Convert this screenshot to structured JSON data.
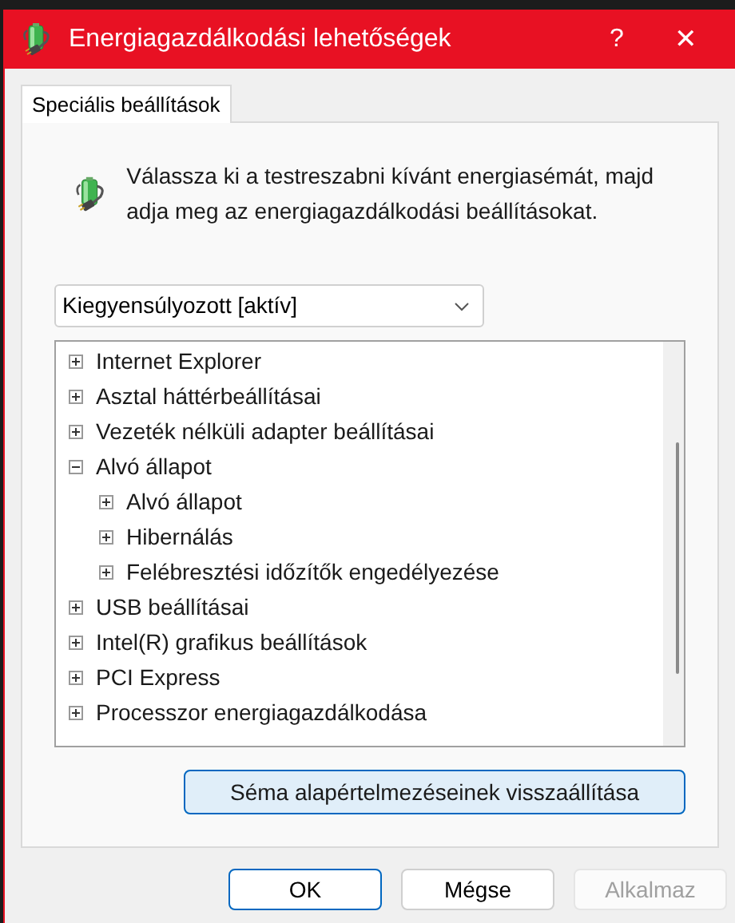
{
  "window": {
    "title": "Energiagazdálkodási lehetőségek",
    "help": "?",
    "close": "✕"
  },
  "tabs": [
    {
      "label": "Speciális beállítások",
      "selected": true
    }
  ],
  "instruction": "Válassza ki a testreszabni kívánt energiasémát, majd adja meg az energiagazdálkodási beállításokat.",
  "plan_select": {
    "value": "Kiegyensúlyozott [aktív]"
  },
  "tree": [
    {
      "label": "Internet Explorer",
      "expanded": false
    },
    {
      "label": "Asztal háttérbeállításai",
      "expanded": false
    },
    {
      "label": "Vezeték nélküli adapter beállításai",
      "expanded": false
    },
    {
      "label": "Alvó állapot",
      "expanded": true,
      "children": [
        {
          "label": "Alvó állapot",
          "expanded": false
        },
        {
          "label": "Hibernálás",
          "expanded": false
        },
        {
          "label": "Felébresztési időzítők engedélyezése",
          "expanded": false
        }
      ]
    },
    {
      "label": "USB beállításai",
      "expanded": false
    },
    {
      "label": "Intel(R) grafikus beállítások",
      "expanded": false
    },
    {
      "label": "PCI Express",
      "expanded": false
    },
    {
      "label": "Processzor energiagazdálkodása",
      "expanded": false
    }
  ],
  "reset_button": "Séma alapértelmezéseinek visszaállítása",
  "buttons": [
    {
      "label": "OK",
      "kind": "default",
      "disabled": false
    },
    {
      "label": "Mégse",
      "kind": "normal",
      "disabled": false
    },
    {
      "label": "Alkalmaz",
      "kind": "normal",
      "disabled": true
    }
  ]
}
